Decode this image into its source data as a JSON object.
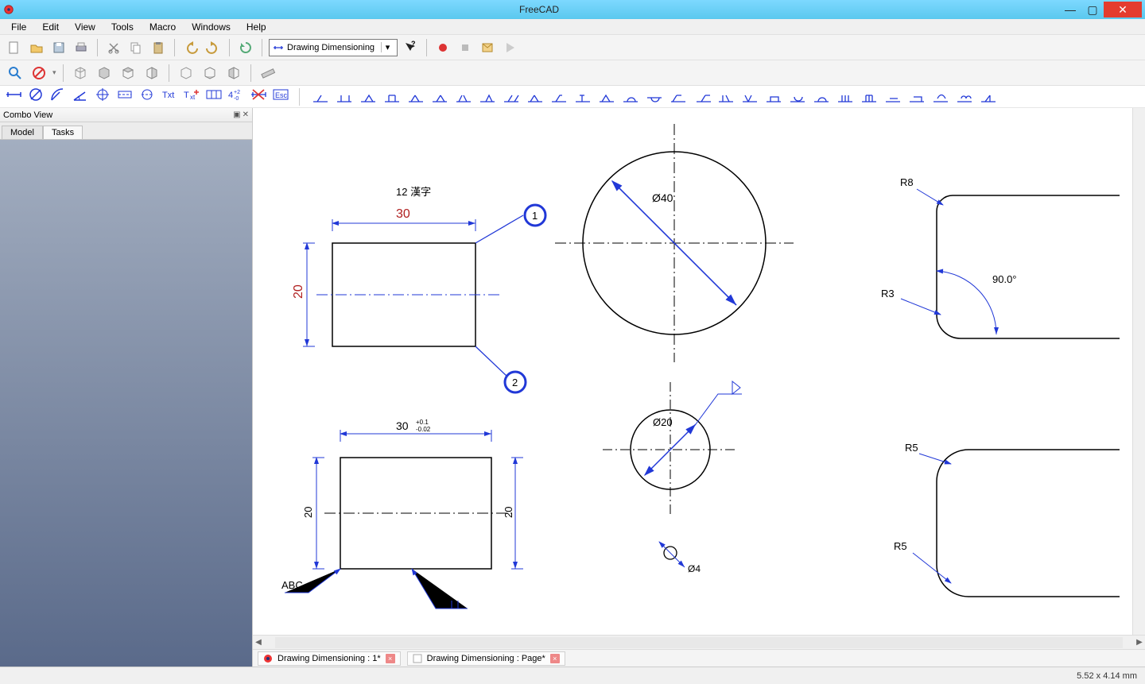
{
  "window": {
    "title": "FreeCAD",
    "minimize": "—",
    "maximize": "▢",
    "close": "✕"
  },
  "menu": [
    "File",
    "Edit",
    "View",
    "Tools",
    "Macro",
    "Windows",
    "Help"
  ],
  "workbench": {
    "label": "Drawing Dimensioning"
  },
  "combo_view": {
    "title": "Combo View",
    "tabs": [
      "Model",
      "Tasks"
    ],
    "active_tab_index": 1
  },
  "doc_tabs": [
    "Drawing Dimensioning : 1*",
    "Drawing Dimensioning : Page*"
  ],
  "status": {
    "coords": "5.52 x 4.14 mm"
  },
  "drawing": {
    "text_note": "12 漢字",
    "dim_top_30": "30",
    "dim_left_20": "20",
    "balloon_1": "1",
    "balloon_2": "2",
    "dia_40": "Ø40",
    "r8": "R8",
    "r3": "R3",
    "angle90": "90.0°",
    "dim_30_tol": "30",
    "tol_upper": "+0.1",
    "tol_lower": "-0.02",
    "dim_20_l": "20",
    "dim_20_r": "20",
    "abc_note": "ABC",
    "dia_20": "Ø20",
    "dia_4": "Ø4",
    "r5a": "R5",
    "r5b": "R5"
  },
  "colors": {
    "dim": "#2138d7",
    "geom": "#000",
    "accent_red": "#b02020"
  }
}
